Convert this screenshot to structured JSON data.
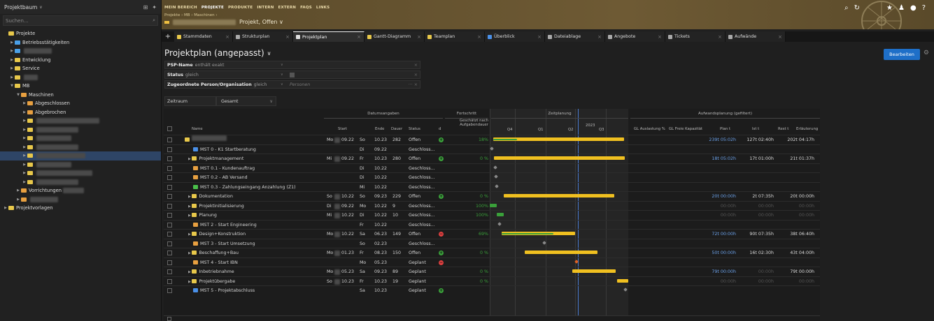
{
  "sidebar": {
    "header": "Projektbaum",
    "search_placeholder": "Suchen...",
    "tree": [
      {
        "label": "Projekte",
        "level": 0,
        "color": "#e8c84a",
        "arrow": ""
      },
      {
        "label": "Betriebsstätigkeiten",
        "level": 1,
        "color": "#4aa0e8",
        "arrow": "▶"
      },
      {
        "label": "",
        "level": 1,
        "color": "#4aa0e8",
        "arrow": "▶",
        "blur": 40
      },
      {
        "label": "Entwicklung",
        "level": 1,
        "color": "#e8c84a",
        "arrow": "▶"
      },
      {
        "label": "Service",
        "level": 1,
        "color": "#e8c84a",
        "arrow": "▶"
      },
      {
        "label": "",
        "level": 1,
        "color": "#e8c84a",
        "arrow": "▶",
        "blur": 20
      },
      {
        "label": "MB",
        "level": 1,
        "color": "#e8c84a",
        "arrow": "▼"
      },
      {
        "label": "Maschinen",
        "level": 2,
        "color": "#e8a040",
        "arrow": "▼"
      },
      {
        "label": "Abgeschlossen",
        "level": 3,
        "color": "#e8a040",
        "arrow": "▶"
      },
      {
        "label": "Abgebrochen",
        "level": 3,
        "color": "#e8a040",
        "arrow": "▶"
      },
      {
        "label": "",
        "level": 3,
        "color": "#e8c84a",
        "arrow": "▶",
        "blur": 90
      },
      {
        "label": "",
        "level": 3,
        "color": "#e8c84a",
        "arrow": "▶",
        "blur": 60
      },
      {
        "label": "",
        "level": 3,
        "color": "#e8c84a",
        "arrow": "▶",
        "blur": 50
      },
      {
        "label": "",
        "level": 3,
        "color": "#e8c84a",
        "arrow": "▶",
        "blur": 60
      },
      {
        "label": "",
        "level": 3,
        "color": "#e8c84a",
        "arrow": "▶",
        "blur": 70,
        "selected": true
      },
      {
        "label": "",
        "level": 3,
        "color": "#e8c84a",
        "arrow": "▶",
        "blur": 50
      },
      {
        "label": "",
        "level": 3,
        "color": "#e8c84a",
        "arrow": "▶",
        "blur": 80
      },
      {
        "label": "",
        "level": 3,
        "color": "#e8c84a",
        "arrow": "▶",
        "blur": 60
      },
      {
        "label": "Vorrichtungen",
        "level": 2,
        "color": "#e8a040",
        "arrow": "▶",
        "blur": 30
      },
      {
        "label": "",
        "level": 2,
        "color": "#e8a040",
        "arrow": "▶",
        "blur": 40
      },
      {
        "label": "Projektvorlagen",
        "level": 0,
        "color": "#e8c84a",
        "arrow": "▶"
      }
    ]
  },
  "topbar": {
    "nav": [
      "MEIN BEREICH",
      "PROJEKTE",
      "PRODUKTE",
      "INTERN",
      "EXTERN",
      "FAQS",
      "LINKS"
    ],
    "active_nav": "PROJEKTE",
    "breadcrumb": "Projekte › MB › Maschinen ›",
    "project_status": "Projekt, Offen ∨"
  },
  "tabs": [
    {
      "label": "Stammdaten",
      "color": "#e8c84a"
    },
    {
      "label": "Strukturplan",
      "color": "#aaaaaa"
    },
    {
      "label": "Projektplan",
      "color": "#dddddd",
      "active": true
    },
    {
      "label": "Gantt-Diagramm",
      "color": "#e8c84a"
    },
    {
      "label": "Teamplan",
      "color": "#e8c84a"
    },
    {
      "label": "Überblick",
      "color": "#4a90e8"
    },
    {
      "label": "Dateiablage",
      "color": "#aaaaaa"
    },
    {
      "label": "Angebote",
      "color": "#aaaaaa"
    },
    {
      "label": "Tickets",
      "color": "#aaaaaa"
    },
    {
      "label": "Aufwände",
      "color": "#aaaaaa"
    }
  ],
  "main": {
    "title": "Projektplan (angepasst)",
    "edit_button": "Bearbeiten",
    "filters": [
      {
        "field": "PSP-Name",
        "op": "enthält exakt",
        "value": ""
      },
      {
        "field": "Status",
        "op": "gleich",
        "value": ""
      },
      {
        "field": "Zugeordnete Person/Organisation",
        "op": "gleich",
        "value": "Personen"
      }
    ],
    "range_label": "Zeitraum",
    "range_value": "Gesamt"
  },
  "table": {
    "groups": {
      "dates": "Datumsangaben",
      "progress": "Fortschritt",
      "timeline": "Zeitplanung",
      "effort": "Aufwandsplanung (gefiltert)"
    },
    "columns": {
      "name": "Name",
      "start": "Start",
      "end": "Ende",
      "dauer": "Dauer",
      "status": "Status",
      "d": "d",
      "geschaetzt": "Geschätzt nach Aufgabendauer",
      "gl_auslastung": "GL Auslastung %",
      "gl_frei": "GL Freie Kapazität",
      "plan": "Plan t",
      "ist": "Ist t",
      "rest": "Rest t",
      "erlaeuterung": "Erläuterung"
    },
    "year": "2023",
    "quarters": [
      "Q4",
      "Q1",
      "Q2",
      "Q3"
    ],
    "rows": [
      {
        "name": "",
        "icon": "#e8c84a",
        "indent": 0,
        "blur": 50,
        "sd": "Mo",
        "s": "09.22",
        "ed": "So",
        "e": "10.23",
        "dauer": "282",
        "status": "Offen",
        "d": "+",
        "pct": "18%",
        "plan": "239t 05:02h",
        "ist": "127t 02:40h",
        "rest": "202t 04:17h"
      },
      {
        "name": "MST 0 - K1 Startberatung",
        "icon": "#4a90e8",
        "indent": 1,
        "sd": "",
        "s": "",
        "ed": "Di",
        "e": "09.22",
        "dauer": "",
        "status": "Geschloss...",
        "d": "",
        "pct": "",
        "plan": "",
        "ist": "",
        "rest": ""
      },
      {
        "name": "Projektmanagement",
        "icon": "#e8c84a",
        "indent": 1,
        "arrow": true,
        "sd": "Mi",
        "s": "09.22",
        "ed": "Fr",
        "e": "10.23",
        "dauer": "280",
        "status": "Offen",
        "d": "+",
        "pct": "0 %",
        "plan": "18t 05:02h",
        "ist": "17t 01:00h",
        "rest": "21t 01:37h"
      },
      {
        "name": "MST 0.1 - Kundenauftrag",
        "icon": "#e8a040",
        "indent": 1,
        "sd": "",
        "s": "",
        "ed": "Di",
        "e": "10.22",
        "dauer": "",
        "status": "Geschloss...",
        "d": "",
        "pct": "",
        "plan": "",
        "ist": "",
        "rest": ""
      },
      {
        "name": "MST 0.2 - AB Versand",
        "icon": "#e8a040",
        "indent": 1,
        "sd": "",
        "s": "",
        "ed": "Di",
        "e": "10.22",
        "dauer": "",
        "status": "Geschloss...",
        "d": "",
        "pct": "",
        "plan": "",
        "ist": "",
        "rest": ""
      },
      {
        "name": "MST 0.3 - Zahlungseingang Anzahlung (Z1)",
        "icon": "#4ac04a",
        "indent": 1,
        "sd": "",
        "s": "",
        "ed": "Mi",
        "e": "10.22",
        "dauer": "",
        "status": "Geschloss...",
        "d": "",
        "pct": "",
        "plan": "",
        "ist": "",
        "rest": ""
      },
      {
        "name": "Dokumentation",
        "icon": "#e8c84a",
        "indent": 1,
        "arrow": true,
        "sd": "So",
        "s": "10.22",
        "ed": "So",
        "e": "09.23",
        "dauer": "229",
        "status": "Offen",
        "d": "+",
        "pct": "0 %",
        "plan": "20t 00:00h",
        "ist": "2t 07:35h",
        "rest": "20t 00:00h"
      },
      {
        "name": "Projektinitialisierung",
        "icon": "#e8c84a",
        "indent": 1,
        "arrow": true,
        "sd": "Di",
        "s": "09.22",
        "ed": "Mo",
        "e": "10.22",
        "dauer": "9",
        "status": "Geschloss...",
        "d": "",
        "pct": "100%",
        "plan": "00:00h",
        "ist": "00:00h",
        "rest": "00:00h",
        "dimeffort": true
      },
      {
        "name": "Planung",
        "icon": "#e8c84a",
        "indent": 1,
        "arrow": true,
        "sd": "Mi",
        "s": "10.22",
        "ed": "Di",
        "e": "10.22",
        "dauer": "10",
        "status": "Geschloss...",
        "d": "",
        "pct": "100%",
        "plan": "00:00h",
        "ist": "00:00h",
        "rest": "00:00h",
        "dimeffort": true
      },
      {
        "name": "MST 2 - Start Engineering",
        "icon": "#e8a040",
        "indent": 1,
        "sd": "",
        "s": "",
        "ed": "Fr",
        "e": "10.22",
        "dauer": "",
        "status": "Geschloss...",
        "d": "",
        "pct": "",
        "plan": "",
        "ist": "",
        "rest": ""
      },
      {
        "name": "Design+Konstruktion",
        "icon": "#e8c84a",
        "indent": 1,
        "arrow": true,
        "sd": "Mo",
        "s": "10.22",
        "ed": "Sa",
        "e": "06.23",
        "dauer": "149",
        "status": "Offen",
        "d": "−",
        "pct": "69%",
        "plan": "72t 00:00h",
        "ist": "90t 07:35h",
        "rest": "38t 06:40h"
      },
      {
        "name": "MST 3 - Start Umsetzung",
        "icon": "#e8a040",
        "indent": 1,
        "sd": "",
        "s": "",
        "ed": "So",
        "e": "02.23",
        "dauer": "",
        "status": "Geschloss...",
        "d": "",
        "pct": "",
        "plan": "",
        "ist": "",
        "rest": ""
      },
      {
        "name": "Beschaffung+Bau",
        "icon": "#e8c84a",
        "indent": 1,
        "arrow": true,
        "sd": "Mo",
        "s": "01.23",
        "ed": "Fr",
        "e": "08.23",
        "dauer": "150",
        "status": "Offen",
        "d": "+",
        "pct": "0 %",
        "plan": "50t 00:00h",
        "ist": "16t 02:30h",
        "rest": "43t 04:00h"
      },
      {
        "name": "MST 4 - Start IBN",
        "icon": "#e8a040",
        "indent": 1,
        "sd": "",
        "s": "",
        "ed": "Mo",
        "e": "05.23",
        "dauer": "",
        "status": "Geplant",
        "d": "−",
        "pct": "",
        "plan": "",
        "ist": "",
        "rest": ""
      },
      {
        "name": "Inbetriebnahme",
        "icon": "#e8c84a",
        "indent": 1,
        "arrow": true,
        "sd": "Mo",
        "s": "05.23",
        "ed": "Sa",
        "e": "09.23",
        "dauer": "89",
        "status": "Geplant",
        "d": "",
        "pct": "0 %",
        "plan": "79t 00:00h",
        "ist": "00:00h",
        "rest": "79t 00:00h",
        "dimist": true
      },
      {
        "name": "Projektübergabe",
        "icon": "#e8c84a",
        "indent": 1,
        "arrow": true,
        "sd": "So",
        "s": "10.23",
        "ed": "Fr",
        "e": "10.23",
        "dauer": "19",
        "status": "Geplant",
        "d": "",
        "pct": "0 %",
        "plan": "00:00h",
        "ist": "00:00h",
        "rest": "00:00h",
        "dimeffort": true
      },
      {
        "name": "MST 5 - Projektabschluss",
        "icon": "#4a90e8",
        "indent": 1,
        "sd": "",
        "s": "",
        "ed": "Sa",
        "e": "10.23",
        "dauer": "",
        "status": "Geplant",
        "d": "+",
        "pct": "",
        "plan": "",
        "ist": "",
        "rest": ""
      }
    ]
  }
}
